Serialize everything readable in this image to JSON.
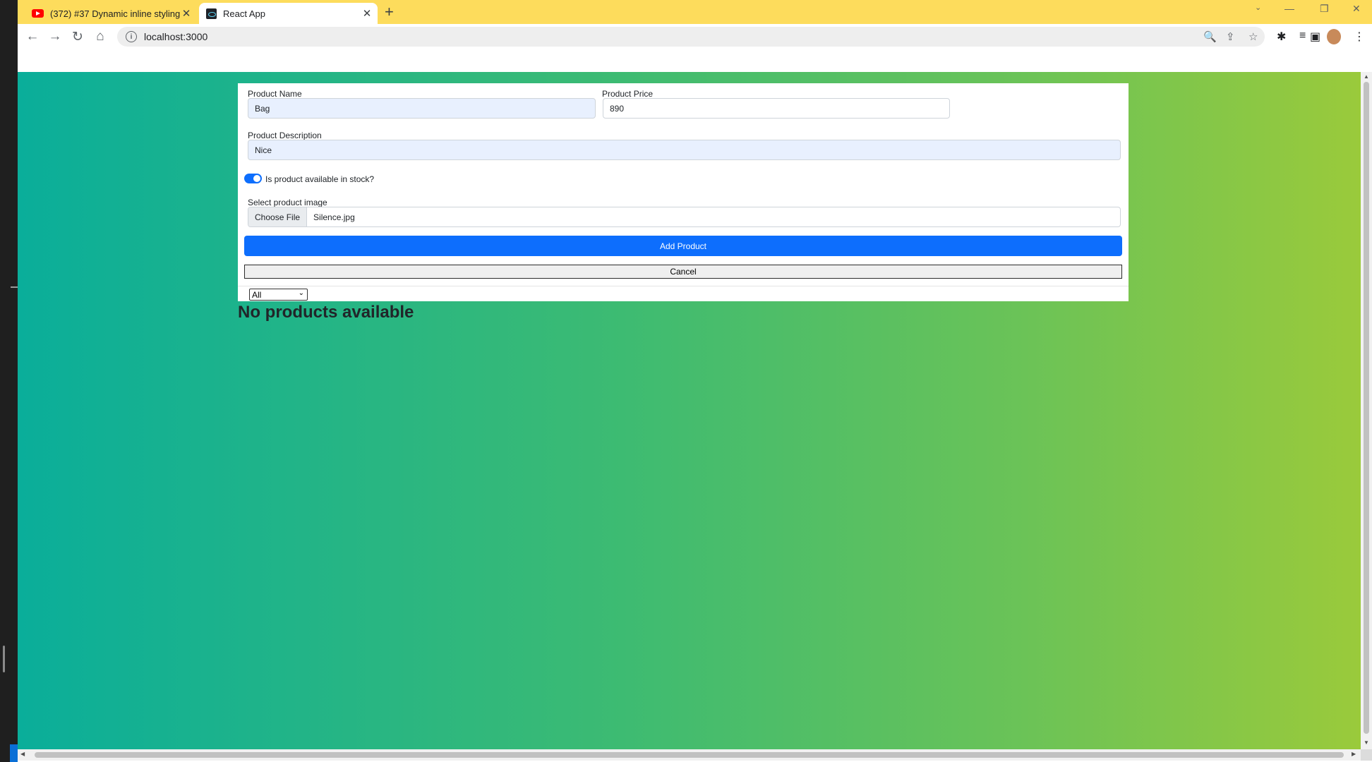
{
  "browser": {
    "tabs": [
      {
        "title": "(372) #37 Dynamic inline styling",
        "close": "✕",
        "favicon": "youtube-icon"
      },
      {
        "title": "React App",
        "close": "✕",
        "favicon": "react-icon"
      }
    ],
    "new_tab": "+",
    "window_controls": {
      "minimize": "—",
      "restore": "❐",
      "close": "✕"
    },
    "nav": {
      "back": "←",
      "forward": "→",
      "reload": "↻",
      "home": "⌂"
    },
    "address": "localhost:3000",
    "toolbar_icons": {
      "zoom": "🔍",
      "share": "⇪",
      "bookmark": "☆",
      "extensions": "✱",
      "media": "≡",
      "sidepanel": "▣",
      "menu": "⋮"
    }
  },
  "form": {
    "name_label": "Product Name",
    "name_value": "Bag",
    "price_label": "Product Price",
    "price_value": "890",
    "description_label": "Product Description",
    "description_value": "Nice",
    "stock_label": "Is product available in stock?",
    "stock_checked": true,
    "image_label": "Select product image",
    "choose_file": "Choose File",
    "file_name": "Silence.jpg",
    "add_button": "Add Product",
    "cancel_button": "Cancel"
  },
  "filter": {
    "selected": "All",
    "chevron": "⌄"
  },
  "empty_message": "No products available",
  "colors": {
    "primary": "#0d6efd",
    "tabstrip": "#fddc5c",
    "gradient_start": "#0aae9a",
    "gradient_end": "#9aca3b"
  }
}
